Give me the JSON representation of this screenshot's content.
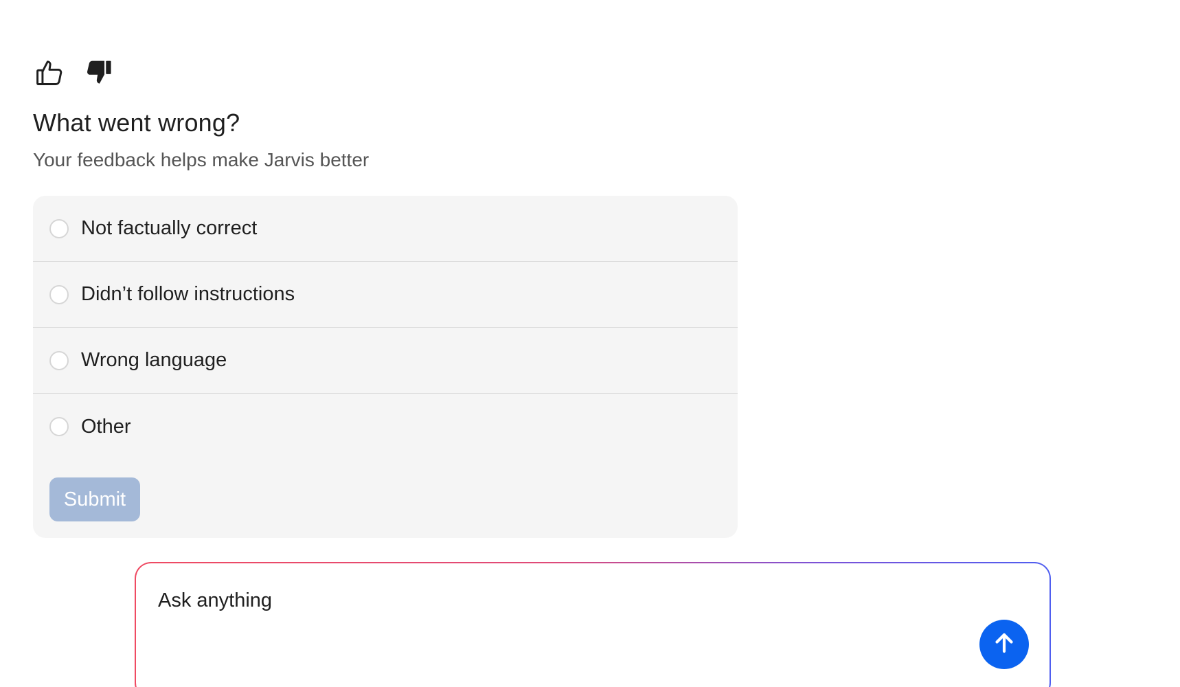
{
  "feedback": {
    "icons": {
      "like": "thumbs-up-outline-icon",
      "dislike": "thumbs-down-filled-icon"
    },
    "title": "What went wrong?",
    "subtitle": "Your feedback helps make Jarvis better",
    "options": [
      {
        "label": "Not factually correct"
      },
      {
        "label": "Didn’t follow instructions"
      },
      {
        "label": "Wrong language"
      },
      {
        "label": "Other"
      }
    ],
    "submit_label": "Submit"
  },
  "composer": {
    "placeholder": "Ask anything",
    "send_icon": "arrow-up-icon"
  },
  "colors": {
    "submit_disabled": "#a4b9d8",
    "send_button": "#0b63f0",
    "card_background": "#f5f5f5",
    "composer_gradient_start": "#ef4a62",
    "composer_gradient_end": "#4f5ef0"
  }
}
